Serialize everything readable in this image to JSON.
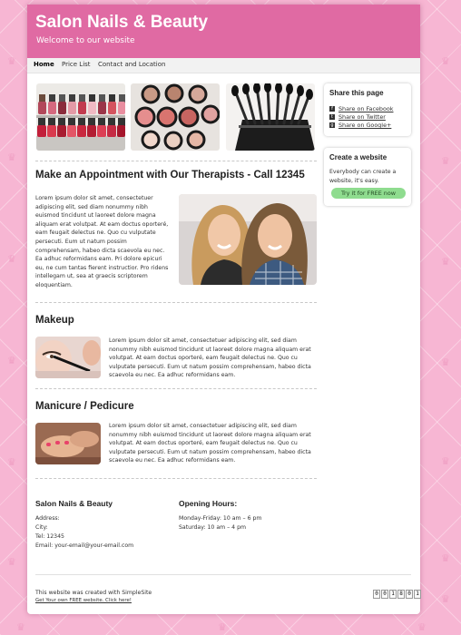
{
  "site": {
    "title": "Salon Nails & Beauty",
    "subtitle": "Welcome to our website"
  },
  "nav": [
    {
      "label": "Home",
      "active": true
    },
    {
      "label": "Price List",
      "active": false
    },
    {
      "label": "Contact and Location",
      "active": false
    }
  ],
  "main": {
    "heading": "Make an Appointment with Our Therapists - Call 12345",
    "intro": "Lorem ipsum dolor sit amet, consectetuer adipiscing elit, sed diam nonummy nibh euismod tincidunt ut laoreet dolore magna aliquam erat volutpat. At eam doctus oporteré, eam feugait delectus ne. Quo cu vulputate persecuti. Eum ut natum possim comprehensam, habeo dicta scaevola eu nec. Ea adhuc reformidans eam. Pri dolore epicuri eu, ne cum tantas fierent instructior. Pro ridens intellegam ut, sea at graecis scriptorem eloquentiam.",
    "sections": [
      {
        "title": "Makeup",
        "text": "Lorem ipsum dolor sit amet, consectetuer adipiscing elit, sed diam nonummy nibh euismod tincidunt ut laoreet dolore magna aliquam erat volutpat. At eam doctus oporteré, eam feugait delectus ne. Quo cu vulputate persecuti. Eum ut natum possim comprehensam, habeo dicta scaevola eu nec. Ea adhuc reformidans eam."
      },
      {
        "title": "Manicure / Pedicure",
        "text": "Lorem ipsum dolor sit amet, consectetuer adipiscing elit, sed diam nonummy nibh euismod tincidunt ut laoreet dolore magna aliquam erat volutpat. At eam doctus oporteré, eam feugait delectus ne. Quo cu vulputate persecuti. Eum ut natum possim comprehensam, habeo dicta scaevola eu nec. Ea adhuc reformidans eam."
      }
    ]
  },
  "sidebar": {
    "share": {
      "title": "Share this page",
      "links": [
        {
          "icon": "facebook-icon",
          "glyph": "f",
          "label": "Share on Facebook"
        },
        {
          "icon": "twitter-icon",
          "glyph": "t",
          "label": "Share on Twitter"
        },
        {
          "icon": "google-plus-icon",
          "glyph": "g",
          "label": "Share on Google+"
        }
      ]
    },
    "create": {
      "title": "Create a website",
      "text": "Everybody can create a website, it's easy.",
      "button": "Try it for FREE now"
    }
  },
  "contact": {
    "title": "Salon Nails & Beauty",
    "lines": [
      "Address:",
      "City:",
      "Tel: 12345",
      "Email: your-email@your-email.com"
    ]
  },
  "hours": {
    "title": "Opening Hours:",
    "lines": [
      "Monday-Friday: 10 am – 6 pm",
      "Saturday: 10 am – 4 pm"
    ]
  },
  "footer": {
    "credit": "This website was created with SimpleSite",
    "link": "Get Your own FREE website. Click here!"
  },
  "counter": [
    "0",
    "0",
    "1",
    "8",
    "0",
    "1"
  ],
  "colors": {
    "header": "#e06aa3",
    "button": "#8fdc8f",
    "background": "#f7b6d3"
  }
}
